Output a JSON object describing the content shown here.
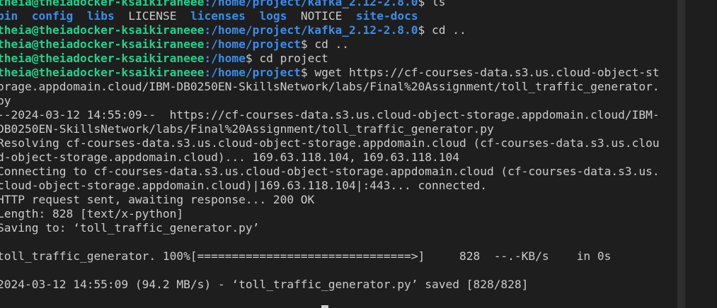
{
  "terminal": {
    "prompt_user": "theia@theiadocker-ksaikiraneee",
    "lines": {
      "l0": {
        "user": "theia@theiadocker-ksaikiraneee",
        "path": ":/home/project/kafka_2.12-2.8.0",
        "cmd": "$ ls"
      },
      "l1": {
        "d1": "bin",
        "d2": "config",
        "d3": "libs",
        "f1": "LICENSE",
        "d4": "licenses",
        "d5": "logs",
        "f2": "NOTICE",
        "d6": "site-docs"
      },
      "l2": {
        "user": "theia@theiadocker-ksaikiraneee",
        "path": ":/home/project/kafka_2.12-2.8.0",
        "cmd": "$ cd .."
      },
      "l3": {
        "user": "theia@theiadocker-ksaikiraneee",
        "path": ":/home/project",
        "cmd": "$ cd .."
      },
      "l4": {
        "user": "theia@theiadocker-ksaikiraneee",
        "path": ":/home",
        "cmd": "$ cd project"
      },
      "l5": {
        "user": "theia@theiadocker-ksaikiraneee",
        "path": ":/home/project",
        "cmd": "$ wget https://cf-courses-data.s3.us.cloud-object-st"
      },
      "l6": "orage.appdomain.cloud/IBM-DB0250EN-SkillsNetwork/labs/Final%20Assignment/toll_traffic_generator.",
      "l7": "py",
      "l8": "--2024-03-12 14:55:09--  https://cf-courses-data.s3.us.cloud-object-storage.appdomain.cloud/IBM-",
      "l9": "DB0250EN-SkillsNetwork/labs/Final%20Assignment/toll_traffic_generator.py",
      "l10": "Resolving cf-courses-data.s3.us.cloud-object-storage.appdomain.cloud (cf-courses-data.s3.us.clou",
      "l11": "d-object-storage.appdomain.cloud)... 169.63.118.104, 169.63.118.104",
      "l12": "Connecting to cf-courses-data.s3.us.cloud-object-storage.appdomain.cloud (cf-courses-data.s3.us.",
      "l13": "cloud-object-storage.appdomain.cloud)|169.63.118.104|:443... connected.",
      "l14": "HTTP request sent, awaiting response... 200 OK",
      "l15": "Length: 828 [text/x-python]",
      "l16": "Saving to: ‘toll_traffic_generator.py’",
      "l17": "",
      "l18": "toll_traffic_generator. 100%[===============================>]     828  --.-KB/s    in 0s",
      "l19": "",
      "l20": "2024-03-12 14:55:09 (94.2 MB/s) - ‘toll_traffic_generator.py’ saved [828/828]"
    }
  },
  "colors": {
    "background": "#1e1e1e",
    "text": "#cccccc",
    "user_green": "#23d18b",
    "path_blue": "#3b8eea"
  }
}
